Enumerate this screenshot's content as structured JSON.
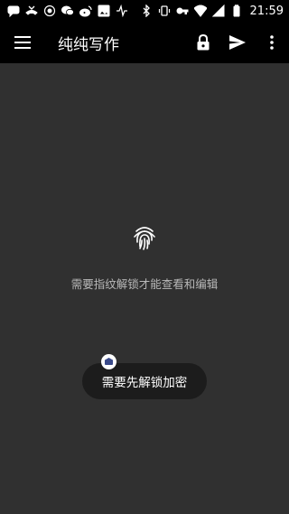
{
  "status_bar": {
    "time": "21:59",
    "left_icons": [
      "chat-icon",
      "missed-call-icon",
      "flower-icon",
      "wechat-icon",
      "weibo-icon",
      "image-icon",
      "pulse-icon"
    ],
    "right_icons": [
      "bluetooth-icon",
      "vibrate-icon",
      "key-icon",
      "wifi-icon",
      "signal-icon",
      "battery-icon"
    ]
  },
  "app_bar": {
    "title": "纯纯写作",
    "menu_icon": "hamburger-icon",
    "actions": [
      "lock-icon",
      "send-icon",
      "more-vert-icon"
    ]
  },
  "lock_screen": {
    "icon": "fingerprint-icon",
    "message": "需要指纹解锁才能查看和编辑"
  },
  "toast": {
    "text": "需要先解锁加密",
    "badge_icon": "app-icon"
  },
  "colors": {
    "background": "#303030",
    "bar": "#000000",
    "toast": "#1c1c1c",
    "message_text": "#b8b8b8"
  }
}
